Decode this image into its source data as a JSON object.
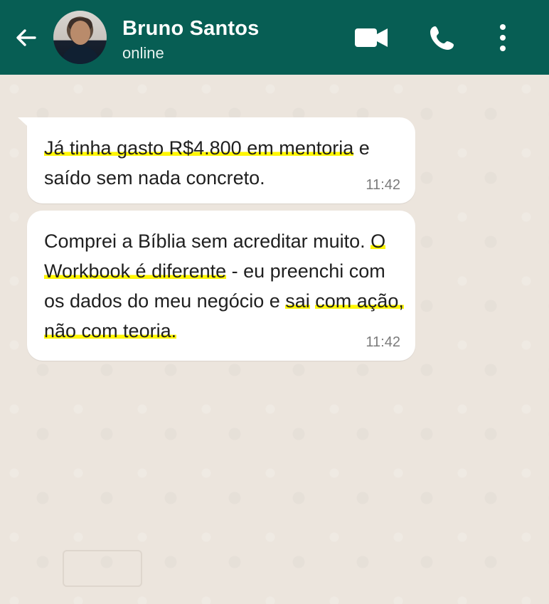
{
  "header": {
    "contact_name": "Bruno Santos",
    "status": "online",
    "icons": {
      "back": "back-arrow-icon",
      "video": "video-call-icon",
      "phone": "phone-icon",
      "menu": "more-vert-icon"
    }
  },
  "messages": [
    {
      "parts": [
        {
          "text": "Já tinha gasto R$4.800 em mentoria",
          "highlight": true
        },
        {
          "text": " e saído sem nada concreto.",
          "highlight": false
        }
      ],
      "time": "11:42"
    },
    {
      "parts": [
        {
          "text": "Comprei a Bíblia sem acreditar muito. ",
          "highlight": false
        },
        {
          "text": "O Workbook é diferente",
          "highlight": true
        },
        {
          "text": " - eu preenchi com os dados do meu negócio e ",
          "highlight": false
        },
        {
          "text": "sai",
          "highlight": true
        },
        {
          "text": " ",
          "highlight": false
        },
        {
          "text": "com ação, não com teoria.",
          "highlight": true
        }
      ],
      "time": "11:42"
    }
  ],
  "colors": {
    "header": "#075e54",
    "chat_background": "#ece5dd",
    "bubble": "#ffffff",
    "highlight": "#fff600"
  }
}
